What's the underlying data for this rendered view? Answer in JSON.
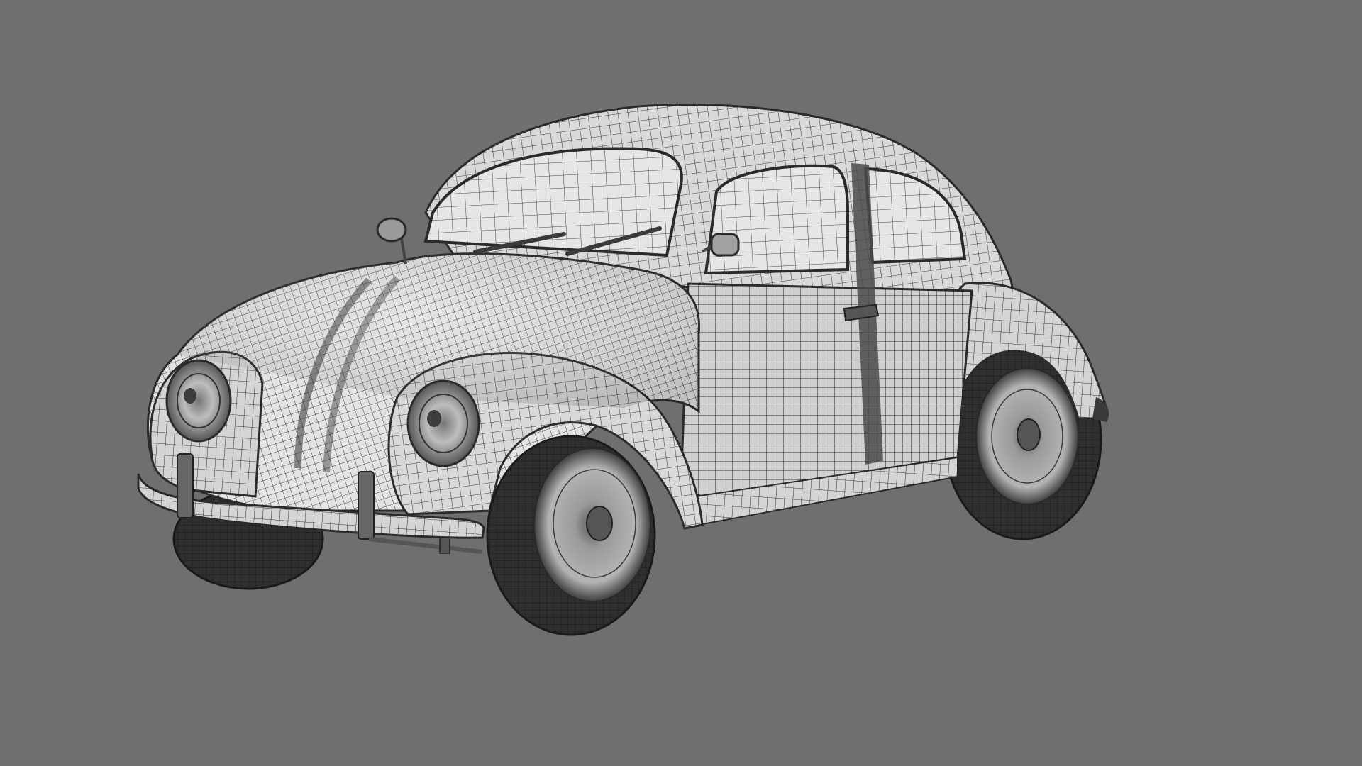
{
  "scene": {
    "background_color": "#6f6f6f",
    "subject": "wireframe-car-render",
    "body_color": "#d7d7d7",
    "wire_color": "#3a3a3a",
    "tire_color": "#2e2e2e",
    "trim_color": "#8a8a8a"
  }
}
